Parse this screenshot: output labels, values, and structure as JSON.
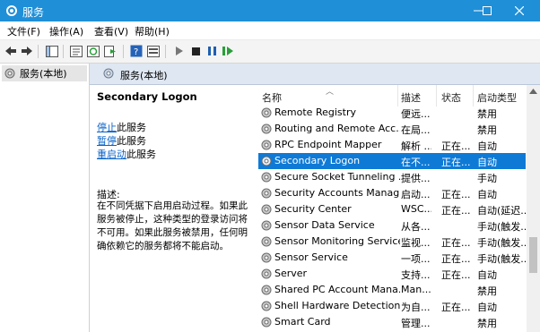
{
  "window": {
    "title": "服务",
    "controls": [
      "minimize-icon",
      "maximize-icon",
      "close-icon"
    ],
    "title_bar_color": "#1f8fd8"
  },
  "menu": {
    "items": [
      "文件(F)",
      "操作(A)",
      "查看(V)",
      "帮助(H)"
    ]
  },
  "toolbar": {
    "buttons": [
      "back-icon",
      "forward-icon",
      "show-hide-tree-icon",
      "properties-icon",
      "refresh-icon",
      "export-list-icon",
      "help-icon",
      "console-icon",
      "start-service-icon",
      "stop-service-icon",
      "pause-service-icon",
      "restart-service-icon"
    ]
  },
  "tree": {
    "root_label": "服务(本地)"
  },
  "main": {
    "header_title": "服务(本地)",
    "selected_service": "Secondary Logon",
    "actions": [
      {
        "link": "停止",
        "suffix": "此服务"
      },
      {
        "link": "暂停",
        "suffix": "此服务"
      },
      {
        "link": "重启动",
        "suffix": "此服务"
      }
    ],
    "description_label": "描述:",
    "description_text": "在不同凭据下启用启动过程。如果此服务被停止，这种类型的登录访问将不可用。如果此服务被禁用，任何明确依赖它的服务都将不能启动。"
  },
  "table": {
    "columns": [
      "名称",
      "描述",
      "状态",
      "启动类型"
    ],
    "rows": [
      {
        "name": "Remote Registry",
        "desc": "便远...",
        "status": "",
        "start": "禁用"
      },
      {
        "name": "Routing and Remote Acc...",
        "desc": "在局...",
        "status": "",
        "start": "禁用"
      },
      {
        "name": "RPC Endpoint Mapper",
        "desc": "解析 ...",
        "status": "正在...",
        "start": "自动"
      },
      {
        "name": "Secondary Logon",
        "desc": "在不...",
        "status": "正在...",
        "start": "自动",
        "selected": true
      },
      {
        "name": "Secure Socket Tunneling ...",
        "desc": "提供...",
        "status": "",
        "start": "手动"
      },
      {
        "name": "Security Accounts Manag...",
        "desc": "启动...",
        "status": "正在...",
        "start": "自动"
      },
      {
        "name": "Security Center",
        "desc": "WSC...",
        "status": "正在...",
        "start": "自动(延迟..."
      },
      {
        "name": "Sensor Data Service",
        "desc": "从各...",
        "status": "",
        "start": "手动(触发..."
      },
      {
        "name": "Sensor Monitoring Service",
        "desc": "监视...",
        "status": "正在...",
        "start": "手动(触发..."
      },
      {
        "name": "Sensor Service",
        "desc": "一项...",
        "status": "正在...",
        "start": "手动(触发..."
      },
      {
        "name": "Server",
        "desc": "支持...",
        "status": "正在...",
        "start": "自动"
      },
      {
        "name": "Shared PC Account Mana...",
        "desc": "Man...",
        "status": "",
        "start": "禁用"
      },
      {
        "name": "Shell Hardware Detection",
        "desc": "为自...",
        "status": "正在...",
        "start": "自动"
      },
      {
        "name": "Smart Card",
        "desc": "管理...",
        "status": "",
        "start": "禁用"
      }
    ],
    "selected_color": "#0f7ad6"
  }
}
